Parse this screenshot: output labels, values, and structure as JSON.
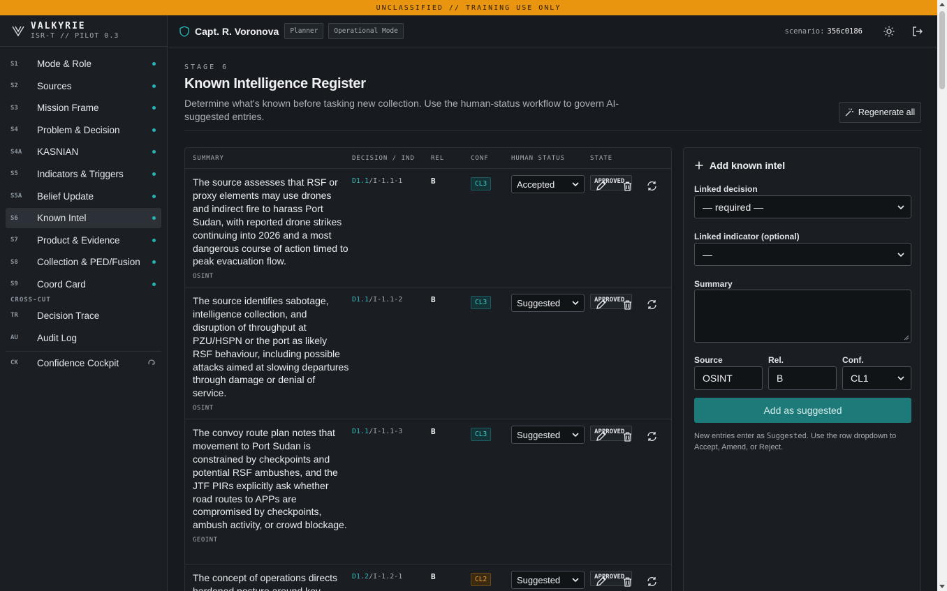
{
  "banner": "UNCLASSIFIED // TRAINING USE ONLY",
  "brand": {
    "name": "VALKYRIE",
    "subtitle": "ISR-T // PILOT 0.3"
  },
  "nav": {
    "items": [
      {
        "code": "S1",
        "label": "Mode & Role"
      },
      {
        "code": "S2",
        "label": "Sources"
      },
      {
        "code": "S3",
        "label": "Mission Frame"
      },
      {
        "code": "S4",
        "label": "Problem & Decision"
      },
      {
        "code": "S4A",
        "label": "KASNIAN"
      },
      {
        "code": "S5",
        "label": "Indicators & Triggers"
      },
      {
        "code": "S5A",
        "label": "Belief Update"
      },
      {
        "code": "S6",
        "label": "Known Intel"
      },
      {
        "code": "S7",
        "label": "Product & Evidence"
      },
      {
        "code": "S8",
        "label": "Collection & PED/Fusion"
      },
      {
        "code": "S9",
        "label": "Coord Card"
      }
    ],
    "cross_cut_label": "CROSS-CUT",
    "cross_cut": [
      {
        "code": "TR",
        "label": "Decision Trace"
      },
      {
        "code": "AU",
        "label": "Audit Log"
      }
    ],
    "cockpit": {
      "code": "CK",
      "label": "Confidence Cockpit"
    }
  },
  "topbar": {
    "user": "Capt. R. Voronova",
    "role_tag": "Planner",
    "mode_tag": "Operational Mode",
    "scenario_label": "scenario:",
    "scenario_id": "356c0186"
  },
  "page": {
    "stage": "STAGE 6",
    "title": "Known Intelligence Register",
    "description": "Determine what's known before tasking new collection. Use the human-status workflow to govern AI-suggested entries.",
    "regenerate_label": "Regenerate all"
  },
  "table": {
    "headers": {
      "summary": "SUMMARY",
      "decision": "DECISION / IND",
      "rel": "REL",
      "conf": "CONF",
      "status": "HUMAN STATUS",
      "state": "STATE"
    },
    "rows": [
      {
        "summary": "The source assesses that RSF or proxy elements may use drones and indirect fire to harass Port Sudan, with reported drone strikes continuing into 2026 and a most dangerous course of action timed to peak evacuation flow.",
        "source": "OSINT",
        "decision": "D1.1",
        "indicator": "I-1.1-1",
        "rel": "B",
        "conf": "CL3",
        "status": "Accepted",
        "state": "APPROVED"
      },
      {
        "summary": "The source identifies sabotage, intelligence collection, and disruption of throughput at PZU/HSPN or the port as likely RSF behaviour, including possible attacks aimed at slowing departures through damage or denial of service.",
        "source": "OSINT",
        "decision": "D1.1",
        "indicator": "I-1.1-2",
        "rel": "B",
        "conf": "CL3",
        "status": "Suggested",
        "state": "APPROVED"
      },
      {
        "summary": "The convoy route plan notes that movement to Port Sudan is constrained by checkpoints and potential RSF ambushes, and the JTF PIRs explicitly ask whether road routes to APPs are compromised by checkpoints, ambush activity, or crowd blockage.",
        "source": "GEOINT",
        "decision": "D1.1",
        "indicator": "I-1.1-3",
        "rel": "B",
        "conf": "CL3",
        "status": "Suggested",
        "state": "APPROVED"
      },
      {
        "summary": "The concept of operations directs hardened posture around key",
        "source": "",
        "decision": "D1.2",
        "indicator": "I-1.2-1",
        "rel": "B",
        "conf": "CL2",
        "status": "Suggested",
        "state": "APPROVED"
      }
    ]
  },
  "form": {
    "title": "Add known intel",
    "linked_decision_label": "Linked decision",
    "linked_decision_value": "— required —",
    "linked_indicator_label": "Linked indicator (optional)",
    "linked_indicator_value": "—",
    "summary_label": "Summary",
    "source_label": "Source",
    "source_value": "OSINT",
    "rel_label": "Rel.",
    "rel_value": "B",
    "conf_label": "Conf.",
    "conf_value": "CL1",
    "submit_label": "Add as suggested",
    "hint_pre": "New entries enter as ",
    "hint_code": "Suggested",
    "hint_post": ". Use the row dropdown to Accept, Amend, or Reject."
  },
  "colors": {
    "banner": "#e9950f",
    "accent": "#26b3b3",
    "button": "#1d7a78",
    "background": "#171a1e"
  }
}
